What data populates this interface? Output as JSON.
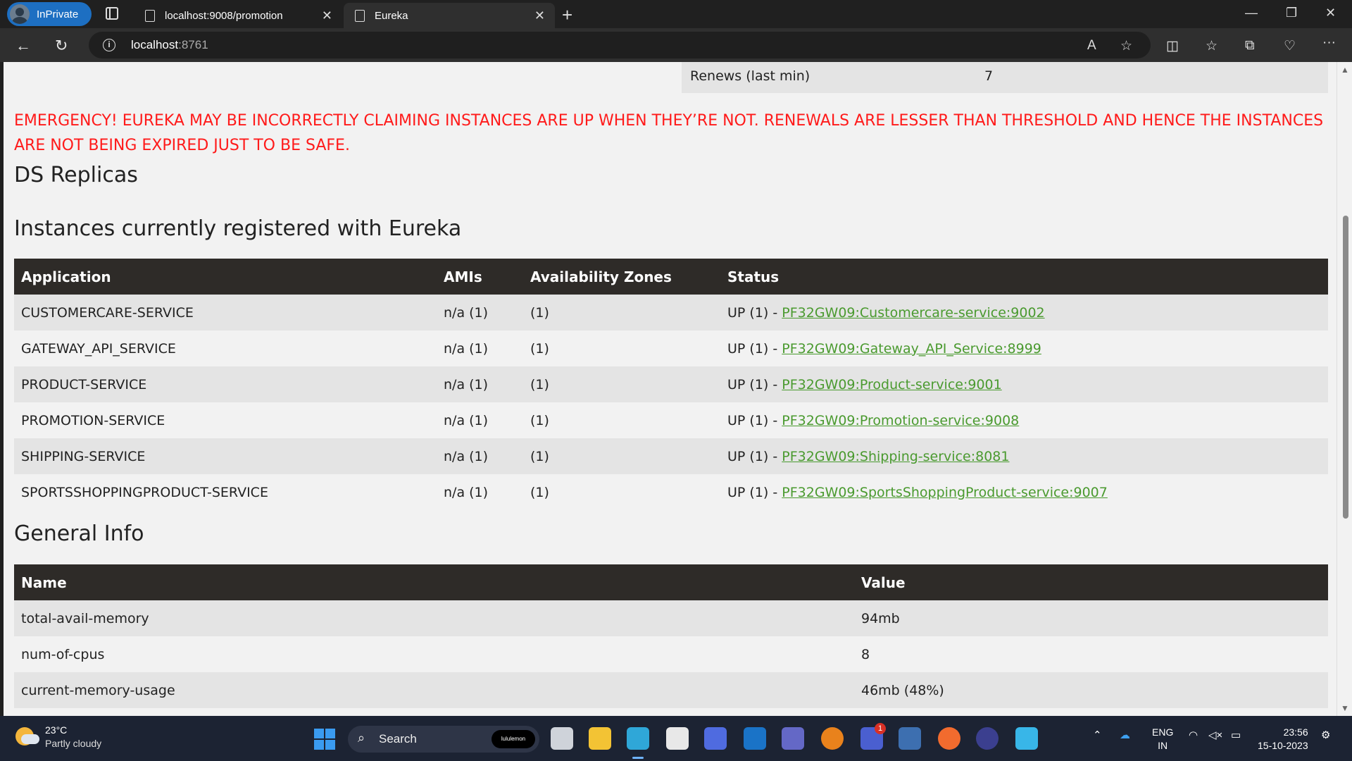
{
  "browser": {
    "inprivate_label": "InPrivate",
    "tabs": [
      {
        "title": "localhost:9008/promotion",
        "active": false
      },
      {
        "title": "Eureka",
        "active": true
      }
    ],
    "address": {
      "host": "localhost",
      "port": ":8761"
    }
  },
  "lease": {
    "label": "Renews (last min)",
    "value": "7"
  },
  "emergency_text": "EMERGENCY! EUREKA MAY BE INCORRECTLY CLAIMING INSTANCES ARE UP WHEN THEY’RE NOT. RENEWALS ARE LESSER THAN THRESHOLD AND HENCE THE INSTANCES ARE NOT BEING EXPIRED JUST TO BE SAFE.",
  "ds_replicas_title": "DS Replicas",
  "instances": {
    "title": "Instances currently registered with Eureka",
    "columns": [
      "Application",
      "AMIs",
      "Availability Zones",
      "Status"
    ],
    "rows": [
      {
        "app": "CUSTOMERCARE-SERVICE",
        "amis": "n/a (1)",
        "zones": "(1)",
        "status": "UP (1) - ",
        "link": "PF32GW09:Customercare-service:9002"
      },
      {
        "app": "GATEWAY_API_SERVICE",
        "amis": "n/a (1)",
        "zones": "(1)",
        "status": "UP (1) - ",
        "link": "PF32GW09:Gateway_API_Service:8999"
      },
      {
        "app": "PRODUCT-SERVICE",
        "amis": "n/a (1)",
        "zones": "(1)",
        "status": "UP (1) - ",
        "link": "PF32GW09:Product-service:9001"
      },
      {
        "app": "PROMOTION-SERVICE",
        "amis": "n/a (1)",
        "zones": "(1)",
        "status": "UP (1) - ",
        "link": "PF32GW09:Promotion-service:9008"
      },
      {
        "app": "SHIPPING-SERVICE",
        "amis": "n/a (1)",
        "zones": "(1)",
        "status": "UP (1) - ",
        "link": "PF32GW09:Shipping-service:8081"
      },
      {
        "app": "SPORTSSHOPPINGPRODUCT-SERVICE",
        "amis": "n/a (1)",
        "zones": "(1)",
        "status": "UP (1) - ",
        "link": "PF32GW09:SportsShoppingProduct-service:9007"
      }
    ]
  },
  "general_info": {
    "title": "General Info",
    "columns": [
      "Name",
      "Value"
    ],
    "rows": [
      {
        "name": "total-avail-memory",
        "value": "94mb"
      },
      {
        "name": "num-of-cpus",
        "value": "8"
      },
      {
        "name": "current-memory-usage",
        "value": "46mb (48%)"
      }
    ]
  },
  "taskbar": {
    "weather_temp": "23°C",
    "weather_desc": "Partly cloudy",
    "search_label": "Search",
    "search_promo": "lululemon",
    "language": "ENG",
    "region": "IN",
    "time": "23:56",
    "date": "15-10-2023",
    "teams_badge": "1"
  },
  "colors": {
    "emergency": "#ff1a1a",
    "table_header": "#2e2b28",
    "link": "#4a9a2f",
    "inprivate": "#1d6fc2"
  }
}
